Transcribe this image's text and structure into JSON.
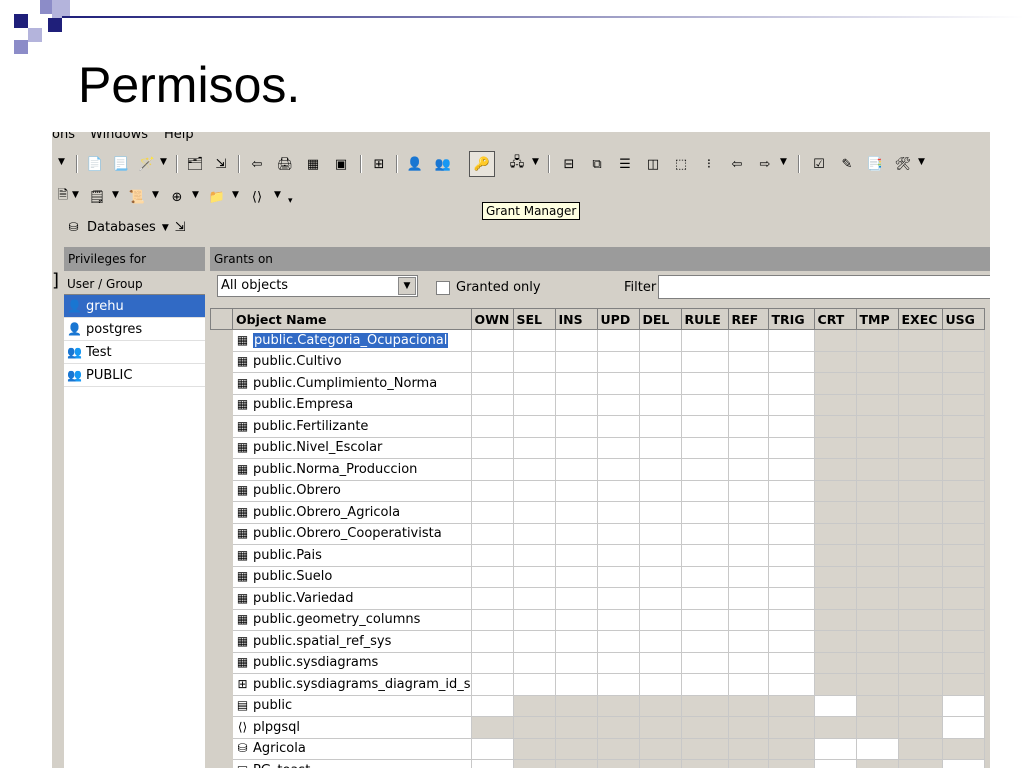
{
  "slide": {
    "title": "Permisos."
  },
  "menu": {
    "items": [
      "ons",
      "Windows",
      "Help"
    ]
  },
  "tooltip": {
    "text": "Grant Manager"
  },
  "databases_button": {
    "label": "Databases"
  },
  "privileges_panel": {
    "header": "Privileges for",
    "list_header": "User / Group",
    "items": [
      {
        "label": "grehu",
        "icon": "user-icon",
        "selected": true
      },
      {
        "label": "postgres",
        "icon": "user-icon",
        "selected": false
      },
      {
        "label": "Test",
        "icon": "group-icon",
        "selected": false
      },
      {
        "label": "PUBLIC",
        "icon": "group-icon",
        "selected": false
      }
    ]
  },
  "grants_panel": {
    "header": "Grants on",
    "object_filter": {
      "value": "All objects"
    },
    "granted_only_label": "Granted only",
    "filter_label": "Filter",
    "filter_value": ""
  },
  "grid": {
    "columns": [
      "Object Name",
      "OWN",
      "SEL",
      "INS",
      "UPD",
      "DEL",
      "RULE",
      "REF",
      "TRIG",
      "CRT",
      "TMP",
      "EXEC",
      "USG"
    ],
    "rows": [
      {
        "name": "public.Categoria_Ocupacional",
        "icon": "table-icon",
        "selected": true,
        "pattern": "www wwwwwwggggg"
      },
      {
        "name": "public.Cultivo",
        "icon": "table-icon",
        "pattern": "table"
      },
      {
        "name": "public.Cumplimiento_Norma",
        "icon": "table-icon",
        "pattern": "table"
      },
      {
        "name": "public.Empresa",
        "icon": "table-icon",
        "pattern": "table"
      },
      {
        "name": "public.Fertilizante",
        "icon": "table-icon",
        "pattern": "table"
      },
      {
        "name": "public.Nivel_Escolar",
        "icon": "table-icon",
        "pattern": "table"
      },
      {
        "name": "public.Norma_Produccion",
        "icon": "table-icon",
        "pattern": "table"
      },
      {
        "name": "public.Obrero",
        "icon": "table-icon",
        "pattern": "table"
      },
      {
        "name": "public.Obrero_Agricola",
        "icon": "table-icon",
        "pattern": "table"
      },
      {
        "name": "public.Obrero_Cooperativista",
        "icon": "table-icon",
        "pattern": "table"
      },
      {
        "name": "public.Pais",
        "icon": "table-icon",
        "pattern": "table"
      },
      {
        "name": "public.Suelo",
        "icon": "table-icon",
        "pattern": "table"
      },
      {
        "name": "public.Variedad",
        "icon": "table-icon",
        "pattern": "table"
      },
      {
        "name": "public.geometry_columns",
        "icon": "table-icon",
        "pattern": "table"
      },
      {
        "name": "public.spatial_ref_sys",
        "icon": "table-icon",
        "pattern": "table"
      },
      {
        "name": "public.sysdiagrams",
        "icon": "table-icon",
        "pattern": "table"
      },
      {
        "name": "public.sysdiagrams_diagram_id_s",
        "icon": "sequence-icon",
        "pattern": "table"
      },
      {
        "name": "public",
        "icon": "schema-icon",
        "pattern": "schema"
      },
      {
        "name": "plpgsql",
        "icon": "language-icon",
        "pattern": "language"
      },
      {
        "name": "Agricola",
        "icon": "database-icon",
        "pattern": "database"
      },
      {
        "name": "PG_toast",
        "icon": "schema-icon",
        "pattern": "schema"
      }
    ]
  },
  "colors": {
    "selection": "#316ac5",
    "panel_header": "#9b9b9b",
    "window_face": "#d4d0c8",
    "deco_navy": "#1f1f7a",
    "deco_periwinkle": "#8c8cc8"
  }
}
